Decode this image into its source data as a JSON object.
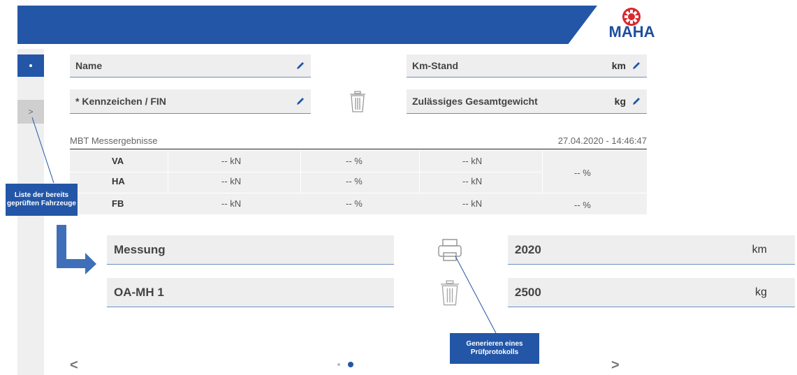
{
  "header": {
    "logo_text": "MAHA",
    "brand_color": "#2356a6",
    "accent_color": "#d7282f"
  },
  "sidebar": {
    "items": [
      {
        "label": "·",
        "active": true
      },
      {
        "label": ">",
        "active": false
      }
    ]
  },
  "form": {
    "name_label": "Name",
    "plate_label": "* Kennzeichen / FIN",
    "km_label": "Km-Stand",
    "km_unit": "km",
    "weight_label": "Zulässiges Gesamtgewicht",
    "weight_unit": "kg"
  },
  "results": {
    "caption": "MBT Messergebnisse",
    "datetime": "27.04.2020 - 14:46:47",
    "rows": [
      {
        "label": "VA",
        "v1": "-- kN",
        "v2": "-- %",
        "v3": "-- kN"
      },
      {
        "label": "HA",
        "v1": "-- kN",
        "v2": "-- %",
        "v3": "-- kN"
      },
      {
        "label": "FB",
        "v1": "-- kN",
        "v2": "-- %",
        "v3": "-- kN"
      }
    ],
    "merged_value": "-- %",
    "fb_value": "-- %"
  },
  "details": {
    "name_value": "Messung",
    "plate_value": "OA-MH 1",
    "km_value": "2020",
    "km_unit": "km",
    "weight_value": "2500",
    "weight_unit": "kg"
  },
  "callouts": {
    "list_label": "Liste der bereits geprüften Fahrzeuge",
    "print_label": "Generieren eines Prüfprotokolls"
  },
  "nav": {
    "prev": "<",
    "next": ">",
    "page_count": 2,
    "current_page": 2
  }
}
